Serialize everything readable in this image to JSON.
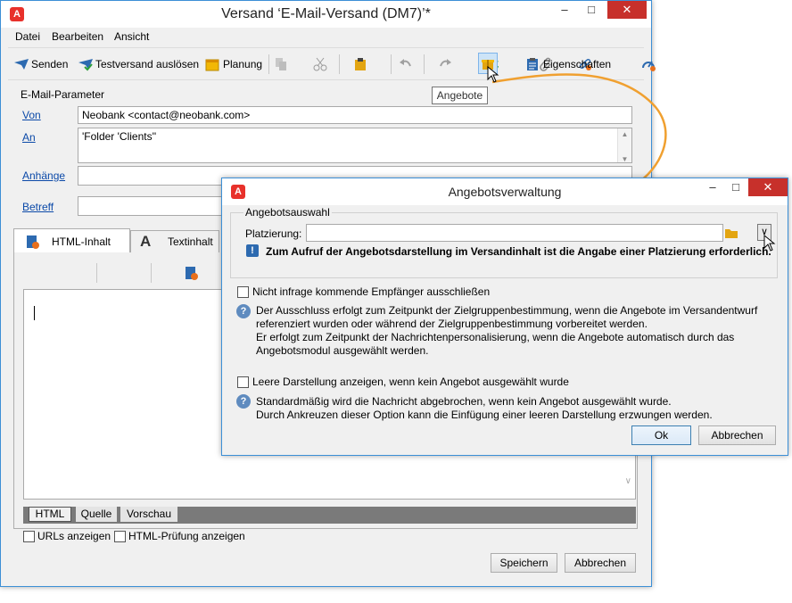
{
  "main_window": {
    "title": "Versand ‘E-Mail-Versand (DM7)’*",
    "logo_letter": "A",
    "menu": [
      "Datei",
      "Bearbeiten",
      "Ansicht"
    ],
    "toolbar": {
      "send": "Senden",
      "test_send": "Testversand auslösen",
      "schedule": "Planung",
      "properties": "Eigenschaften",
      "tooltip": "Angebote"
    },
    "email_params": {
      "group_label": "E-Mail-Parameter",
      "from_label": "Von",
      "from_value": "Neobank <contact@neobank.com>",
      "to_label": "An",
      "to_value": "'Folder 'Clients''",
      "attachments_label": "Anhänge",
      "subject_label": "Betreff"
    },
    "content_tabs": {
      "html_tab": "HTML-Inhalt",
      "text_tab": "Textinhalt"
    },
    "bottom_tabs": [
      "HTML",
      "Quelle",
      "Vorschau"
    ],
    "checkboxes": {
      "show_urls": "URLs anzeigen",
      "html_check": "HTML-Prüfung anzeigen"
    },
    "buttons": {
      "save": "Speichern",
      "cancel": "Abbrechen"
    }
  },
  "dialog": {
    "title": "Angebotsverwaltung",
    "logo_letter": "A",
    "group_label": "Angebotsauswahl",
    "placement_label": "Platzierung:",
    "placement_value": "",
    "warning": "Zum Aufruf der Angebotsdarstellung im Versandinhalt ist die Angabe einer Platzierung erforderlich.",
    "exclude_checkbox": "Nicht infrage kommende Empfänger ausschließen",
    "exclude_info_1": "Der Ausschluss erfolgt zum Zeitpunkt der Zielgruppenbestimmung, wenn die Angebote im Versandentwurf",
    "exclude_info_2": "referenziert wurden oder während der Zielgruppenbestimmung vorbereitet werden.",
    "exclude_info_3": "Er erfolgt zum Zeitpunkt der Nachrichtenpersonalisierung, wenn die Angebote automatisch durch das",
    "exclude_info_4": "Angebotsmodul ausgewählt werden.",
    "empty_checkbox": "Leere Darstellung anzeigen, wenn kein Angebot ausgewählt wurde",
    "empty_info_1": "Standardmäßig wird die Nachricht abgebrochen, wenn kein Angebot ausgewählt wurde.",
    "empty_info_2": "Durch Ankreuzen dieser Option kann die Einfügung einer leeren Darstellung erzwungen werden.",
    "ok": "Ok",
    "cancel": "Abbrechen"
  },
  "colors": {
    "accent": "#3c8fd6",
    "arrow": "#f0a030",
    "close_red": "#c7302b",
    "link": "#0b49a8"
  }
}
